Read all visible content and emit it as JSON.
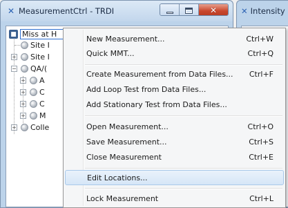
{
  "main_window": {
    "title": "MeasurementCtrl - TRDI",
    "icon": "trdi-logo-icon"
  },
  "second_window": {
    "title": "Intensity"
  },
  "tree": {
    "root_label": "Miss at H",
    "nodes": [
      {
        "label": "Site I"
      },
      {
        "label": "Site I"
      },
      {
        "label": "QA/("
      },
      {
        "label": "A"
      },
      {
        "label": "C"
      },
      {
        "label": "C"
      },
      {
        "label": "M"
      },
      {
        "label": "Colle"
      }
    ]
  },
  "context_menu": {
    "items": [
      {
        "label": "New Measurement...",
        "shortcut": "Ctrl+W"
      },
      {
        "label": "Quick MMT...",
        "shortcut": "Ctrl+Q"
      },
      {
        "label": "Create Measurement from Data Files...",
        "shortcut": "Ctrl+F"
      },
      {
        "label": "Add Loop Test from Data Files...",
        "shortcut": ""
      },
      {
        "label": "Add Stationary Test from Data Files...",
        "shortcut": ""
      },
      {
        "label": "Open Measurement...",
        "shortcut": "Ctrl+O"
      },
      {
        "label": "Save Measurement...",
        "shortcut": "Ctrl+S"
      },
      {
        "label": "Close Measurement",
        "shortcut": "Ctrl+E"
      },
      {
        "label": "Edit Locations...",
        "shortcut": ""
      },
      {
        "label": "Lock Measurement",
        "shortcut": "Ctrl+L"
      }
    ],
    "highlighted_item": "Edit Locations..."
  },
  "colors": {
    "title_bar": "#c9dcf0",
    "close_button": "#c9472d",
    "menu_background": "#f5f6f7",
    "highlight": "#d6e6f7"
  }
}
